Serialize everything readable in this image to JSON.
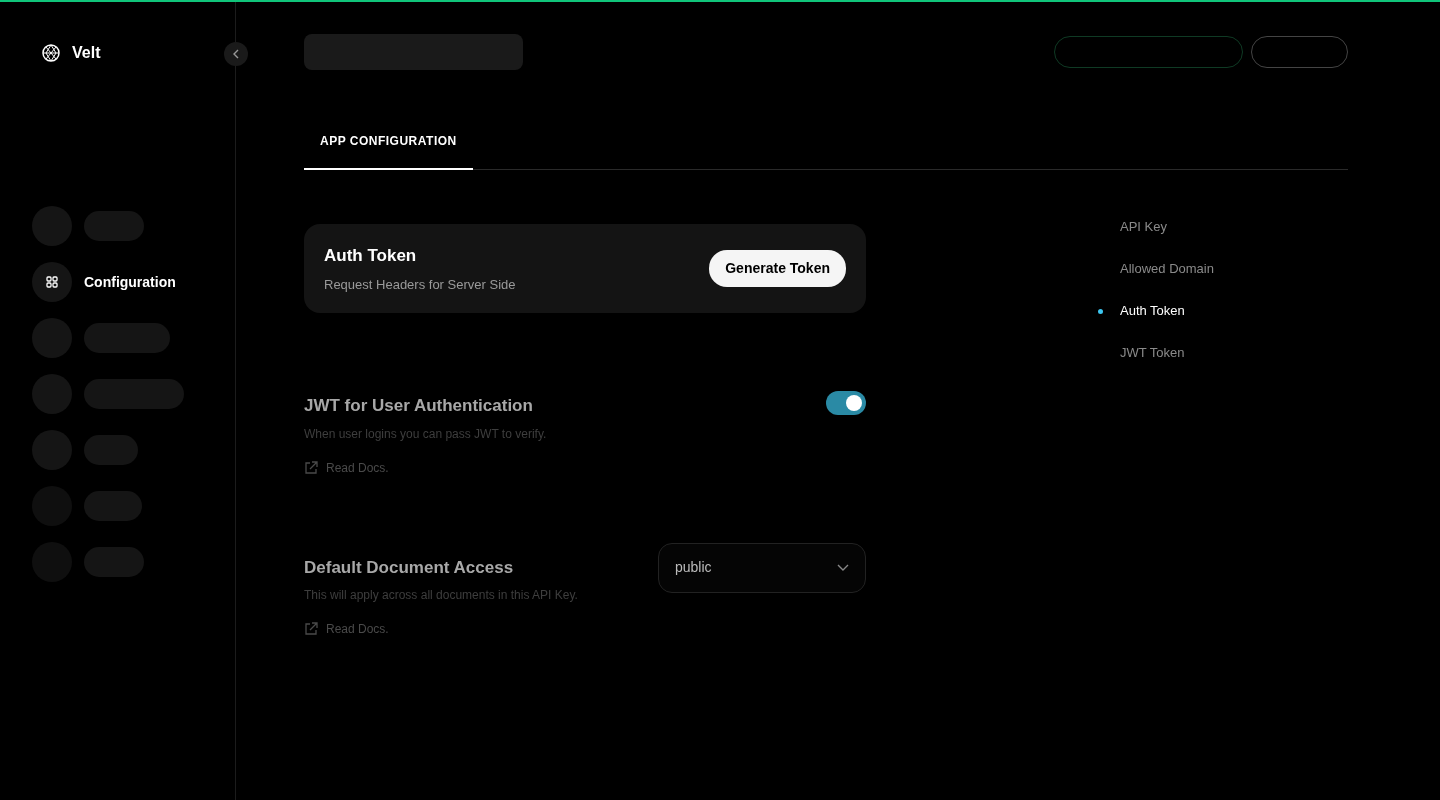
{
  "brand": {
    "name": "Velt"
  },
  "sidebar": {
    "items": [
      {
        "kind": "skeleton"
      },
      {
        "kind": "item",
        "label": "Configuration",
        "selected": true
      },
      {
        "kind": "skeleton"
      },
      {
        "kind": "skeleton"
      },
      {
        "kind": "skeleton"
      },
      {
        "kind": "skeleton"
      },
      {
        "kind": "skeleton"
      }
    ]
  },
  "tabs": [
    {
      "label": "APP CONFIGURATION",
      "selected": true
    }
  ],
  "auth_token": {
    "title": "Auth Token",
    "subtitle": "Request Headers for Server Side",
    "button": "Generate Token"
  },
  "settings": [
    {
      "kind": "toggle",
      "title": "JWT for User Authentication",
      "description": "When user logins you can pass JWT to verify.",
      "link": "Read Docs.",
      "on": true
    },
    {
      "kind": "select",
      "title": "Default Document Access",
      "description": "This will apply across all documents in this API Key.",
      "link": "Read Docs.",
      "value": "public"
    }
  ],
  "section_nav": [
    {
      "label": "API Key",
      "selected": false
    },
    {
      "label": "Allowed Domain",
      "selected": false
    },
    {
      "label": "Auth Token",
      "selected": true
    },
    {
      "label": "JWT Token",
      "selected": false
    }
  ]
}
